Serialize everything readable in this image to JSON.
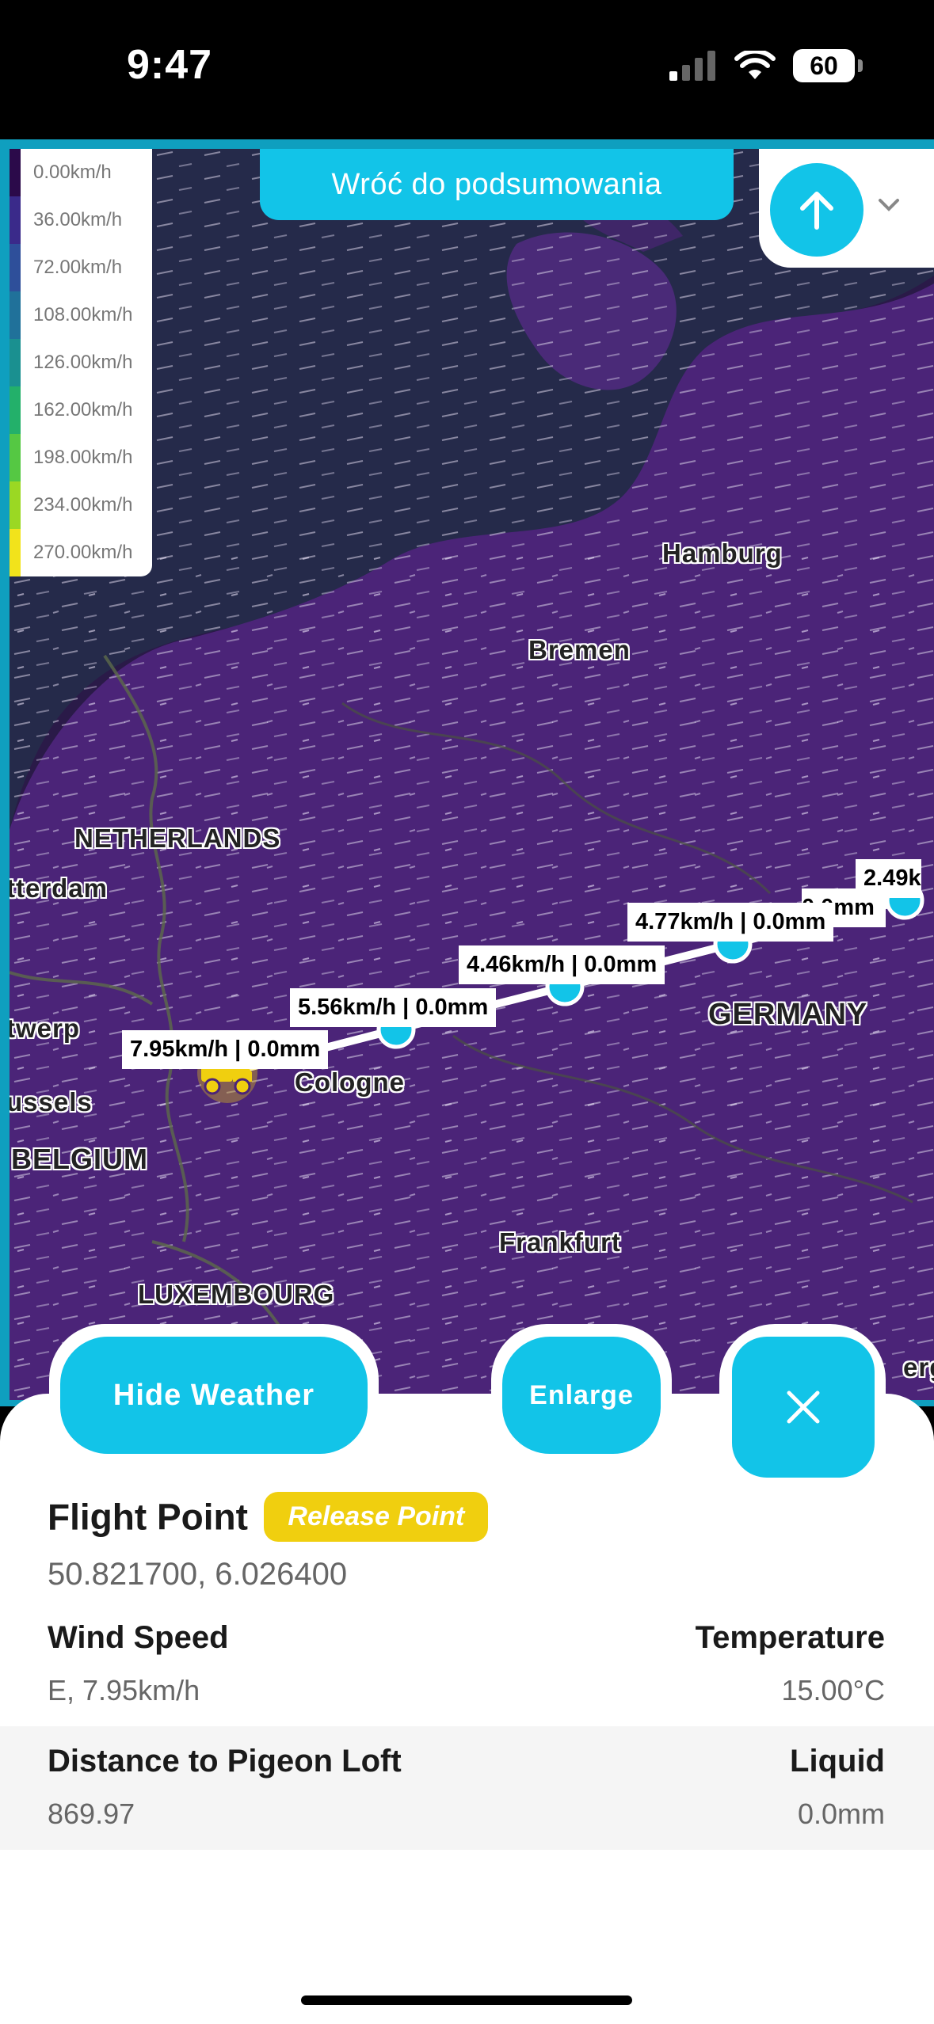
{
  "status": {
    "time": "9:47",
    "battery": "60"
  },
  "legend": [
    {
      "label": "0.00km/h",
      "color": "#2b0a4a"
    },
    {
      "label": "36.00km/h",
      "color": "#3a2a8a"
    },
    {
      "label": "72.00km/h",
      "color": "#2e4f9a"
    },
    {
      "label": "108.00km/h",
      "color": "#20719a"
    },
    {
      "label": "126.00km/h",
      "color": "#1a9090"
    },
    {
      "label": "162.00km/h",
      "color": "#23b06a"
    },
    {
      "label": "198.00km/h",
      "color": "#55c843"
    },
    {
      "label": "234.00km/h",
      "color": "#9bd823"
    },
    {
      "label": "270.00km/h",
      "color": "#f2e31b"
    }
  ],
  "header": {
    "back_label": "Wróć do podsumowania"
  },
  "map_labels": {
    "hamburg": "Hamburg",
    "bremen": "Bremen",
    "netherlands": "NETHERLANDS",
    "rotterdam": "tterdam",
    "antwerp": "twerp",
    "brussels": "ussels",
    "belgium": "BELGIUM",
    "cologne": "Cologne",
    "germany": "GERMANY",
    "frankfurt": "Frankfurt",
    "luxembourg": "LUXEMBOURG",
    "edge_city": "erg"
  },
  "route_tags": {
    "t1": "7.95km/h | 0.0mm",
    "t2": "5.56km/h | 0.0mm",
    "t3": "4.46km/h | 0.0mm",
    "t4": "4.77km/h | 0.0mm",
    "t5": "2.49k",
    "t5_hidden": "0.0mm"
  },
  "buttons": {
    "hide_weather": "Hide Weather",
    "enlarge": "Enlarge"
  },
  "info": {
    "title": "Flight Point",
    "badge": "Release Point",
    "coords": "50.821700, 6.026400",
    "wind_label": "Wind Speed",
    "wind_value": "E, 7.95km/h",
    "temp_label": "Temperature",
    "temp_value": "15.00°C",
    "distance_label": "Distance to Pigeon Loft",
    "distance_value": "869.97",
    "liquid_label": "Liquid",
    "liquid_value": "0.0mm"
  },
  "colors": {
    "accent": "#12c4e8",
    "badge": "#f0cf0f"
  }
}
